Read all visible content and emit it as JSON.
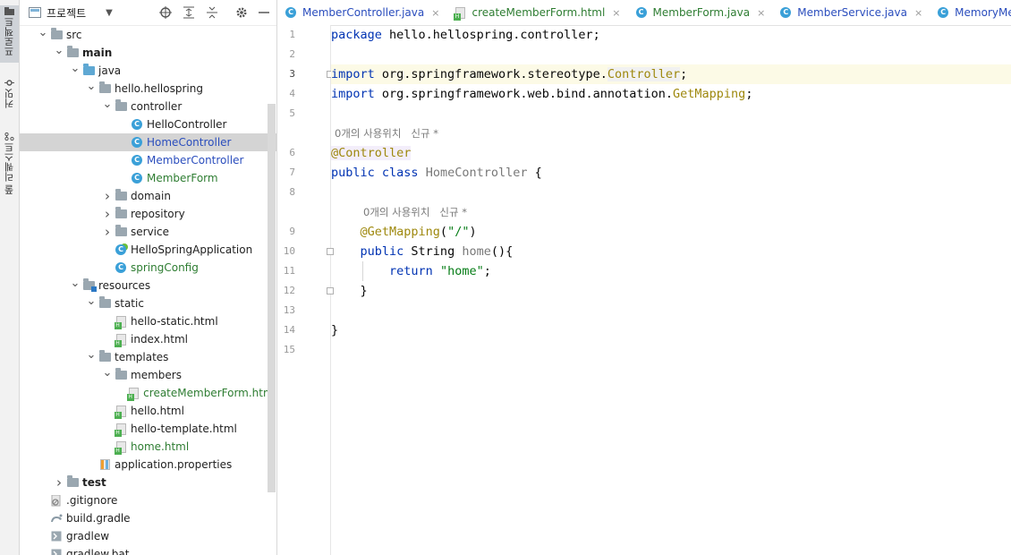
{
  "sidebar_strip": {
    "tabs": [
      {
        "label": "프로젝트"
      },
      {
        "label": "커밋"
      },
      {
        "label": "풀 리퀘스트"
      }
    ]
  },
  "project_panel": {
    "title": "프로젝트",
    "tree": [
      {
        "label": "src",
        "depth": 1,
        "arrow": "down",
        "icon": "folder-icon"
      },
      {
        "label": "main",
        "depth": 2,
        "arrow": "down",
        "icon": "folder-icon",
        "bold": true
      },
      {
        "label": "java",
        "depth": 3,
        "arrow": "down",
        "icon": "source-folder-icon"
      },
      {
        "label": "hello.hellospring",
        "depth": 4,
        "arrow": "down",
        "icon": "package-icon"
      },
      {
        "label": "controller",
        "depth": 5,
        "arrow": "down",
        "icon": "package-icon"
      },
      {
        "label": "HelloController",
        "depth": 6,
        "icon": "class-icon"
      },
      {
        "label": "HomeController",
        "depth": 6,
        "icon": "class-icon",
        "color": "blue",
        "selected": true
      },
      {
        "label": "MemberController",
        "depth": 6,
        "icon": "class-icon",
        "color": "blue"
      },
      {
        "label": "MemberForm",
        "depth": 6,
        "icon": "class-icon",
        "color": "green"
      },
      {
        "label": "domain",
        "depth": 5,
        "arrow": "right",
        "icon": "package-icon"
      },
      {
        "label": "repository",
        "depth": 5,
        "arrow": "right",
        "icon": "package-icon"
      },
      {
        "label": "service",
        "depth": 5,
        "arrow": "right",
        "icon": "package-icon"
      },
      {
        "label": "HelloSpringApplication",
        "depth": 5,
        "icon": "spring-class-icon"
      },
      {
        "label": "springConfig",
        "depth": 5,
        "icon": "class-icon",
        "color": "green"
      },
      {
        "label": "resources",
        "depth": 3,
        "arrow": "down",
        "icon": "resources-folder-icon"
      },
      {
        "label": "static",
        "depth": 4,
        "arrow": "down",
        "icon": "folder-icon"
      },
      {
        "label": "hello-static.html",
        "depth": 5,
        "icon": "html-file-icon"
      },
      {
        "label": "index.html",
        "depth": 5,
        "icon": "html-file-icon"
      },
      {
        "label": "templates",
        "depth": 4,
        "arrow": "down",
        "icon": "folder-icon"
      },
      {
        "label": "members",
        "depth": 5,
        "arrow": "down",
        "icon": "folder-icon"
      },
      {
        "label": "createMemberForm.html",
        "depth": 6,
        "icon": "html-file-icon",
        "color": "green"
      },
      {
        "label": "hello.html",
        "depth": 5,
        "icon": "html-file-icon"
      },
      {
        "label": "hello-template.html",
        "depth": 5,
        "icon": "html-file-icon"
      },
      {
        "label": "home.html",
        "depth": 5,
        "icon": "html-file-icon",
        "color": "green"
      },
      {
        "label": "application.properties",
        "depth": 4,
        "icon": "properties-file-icon"
      },
      {
        "label": "test",
        "depth": 2,
        "arrow": "right",
        "icon": "folder-icon",
        "bold": true
      },
      {
        "label": ".gitignore",
        "depth": 1,
        "icon": "gitignore-file-icon"
      },
      {
        "label": "build.gradle",
        "depth": 1,
        "icon": "gradle-file-icon"
      },
      {
        "label": "gradlew",
        "depth": 1,
        "icon": "script-file-icon"
      },
      {
        "label": "gradlew.bat",
        "depth": 1,
        "icon": "script-file-icon"
      }
    ]
  },
  "editor_tabs": [
    {
      "label": "MemberController.java",
      "icon": "class-icon",
      "color": "blue"
    },
    {
      "label": "createMemberForm.html",
      "icon": "html-file-icon",
      "color": "green"
    },
    {
      "label": "MemberForm.java",
      "icon": "class-icon",
      "color": "green"
    },
    {
      "label": "MemberService.java",
      "icon": "class-icon",
      "color": "blue"
    },
    {
      "label": "MemoryMemberReposito",
      "icon": "class-icon",
      "color": "blue"
    }
  ],
  "editor": {
    "line_numbers": [
      "1",
      "2",
      "3",
      "4",
      "5",
      "6",
      "7",
      "8",
      "9",
      "10",
      "11",
      "12",
      "13",
      "14",
      "15"
    ],
    "usage_hints": [
      {
        "text": "0개의 사용위치",
        "author": "신규 *"
      },
      {
        "text": "0개의 사용위치",
        "author": "신규 *"
      }
    ],
    "code": {
      "l1_kw": "package",
      "l1_rest": " hello.hellospring.controller;",
      "l3_kw": "import",
      "l3_pkg": " org.springframework.stereotype.",
      "l3_cls": "Controller",
      "l3_end": ";",
      "l4_kw": "import",
      "l4_pkg": " org.springframework.web.bind.annotation.",
      "l4_cls": "GetMapping",
      "l4_end": ";",
      "l6_ann": "@Controller",
      "l7_kw1": "public",
      "l7_kw2": "class",
      "l7_name": "HomeController",
      "l7_end": " {",
      "l9_ann": "@GetMapping",
      "l9_open": "(",
      "l9_str": "\"/\"",
      "l9_close": ")",
      "l10_kw": "public",
      "l10_type": " String ",
      "l10_name": "home",
      "l10_end": "(){",
      "l11_kw": "return",
      "l11_str": "\"home\"",
      "l11_end": ";",
      "l12": "}",
      "l14": "}"
    }
  }
}
